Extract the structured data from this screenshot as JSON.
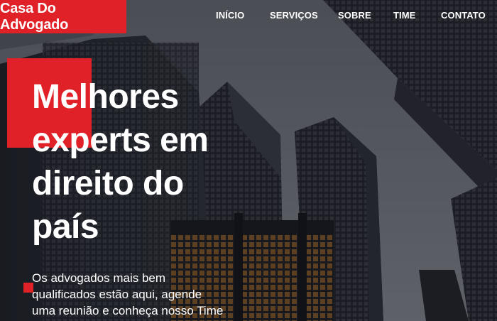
{
  "brand": {
    "logo_text": "Casa Do Advogado",
    "accent_color": "#e02127"
  },
  "nav": {
    "items": [
      {
        "label": "INÍCIO"
      },
      {
        "label": "SERVIÇOS"
      },
      {
        "label": "SOBRE"
      },
      {
        "label": "TIME"
      },
      {
        "label": "CONTATO"
      }
    ]
  },
  "hero": {
    "headline_lines": [
      "Melhores",
      "experts em",
      "direito do",
      "país"
    ],
    "subtitle_lines": [
      "Os advogados mais bem",
      "qualificados estão aqui, agende",
      "uma reunião e conheça nosso Time"
    ],
    "background": "dark city skyscrapers photo"
  }
}
